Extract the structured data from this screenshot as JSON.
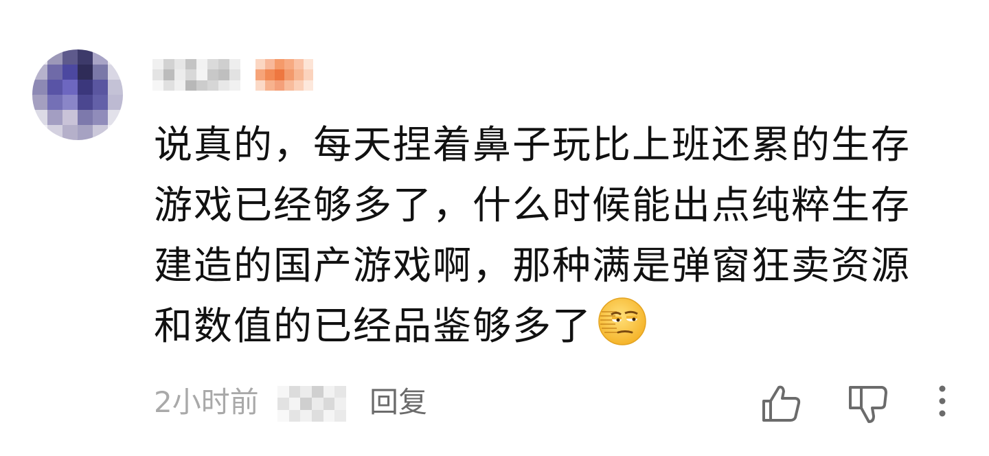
{
  "comment": {
    "username_blurred": true,
    "text_lines": [
      "说真的，每天捏着鼻子玩比上班还累的生存",
      "游戏已经够多了，什么时候能出点纯粹生存",
      "建造的国产游戏啊，那种满是弹窗狂卖资源",
      "和数值的已经品鉴够多了"
    ],
    "emoji": "smirk-face-emoji",
    "timestamp": "2小时前",
    "reply_label": "回复",
    "icons": {
      "like": "thumbs-up-icon",
      "dislike": "thumbs-down-icon",
      "more": "more-vertical-icon"
    },
    "colors": {
      "text": "#111111",
      "meta": "#a9a9a9",
      "reply": "#6b6b6b",
      "icon": "#6b6b6b",
      "badge": "#f59a6a"
    }
  }
}
